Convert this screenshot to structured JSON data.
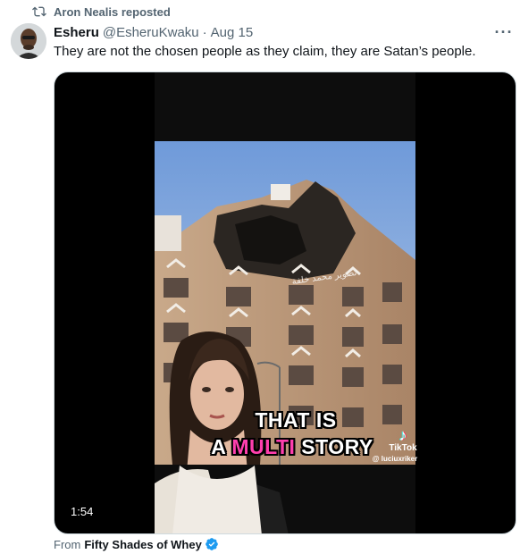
{
  "repost": {
    "text": "Aron Nealis reposted",
    "icon": "repost-icon"
  },
  "tweet": {
    "author_name": "Esheru",
    "author_handle": "@EsheruKwaku",
    "separator": "·",
    "date": "Aug 15",
    "more_label": "···",
    "text": "They are not the chosen people as they claim, they are Satan’s people."
  },
  "video": {
    "watermark_arabic": "تصوير محمد خلفة",
    "caption_line1": "THAT IS",
    "caption_line2_part1": "A ",
    "caption_line2_highlight": "MULTI",
    "caption_line2_part2": " STORY",
    "tiktok_brand": "TikTok",
    "tiktok_user": "@ luciuxriker",
    "duration": "1:54",
    "highlight_color": "#ff3fae"
  },
  "attribution": {
    "from_label": "From",
    "account": "Fifty Shades of Whey",
    "verified_color": "#1d9bf0"
  },
  "colors": {
    "text": "#0f1419",
    "muted": "#536471",
    "accent": "#1d9bf0"
  }
}
